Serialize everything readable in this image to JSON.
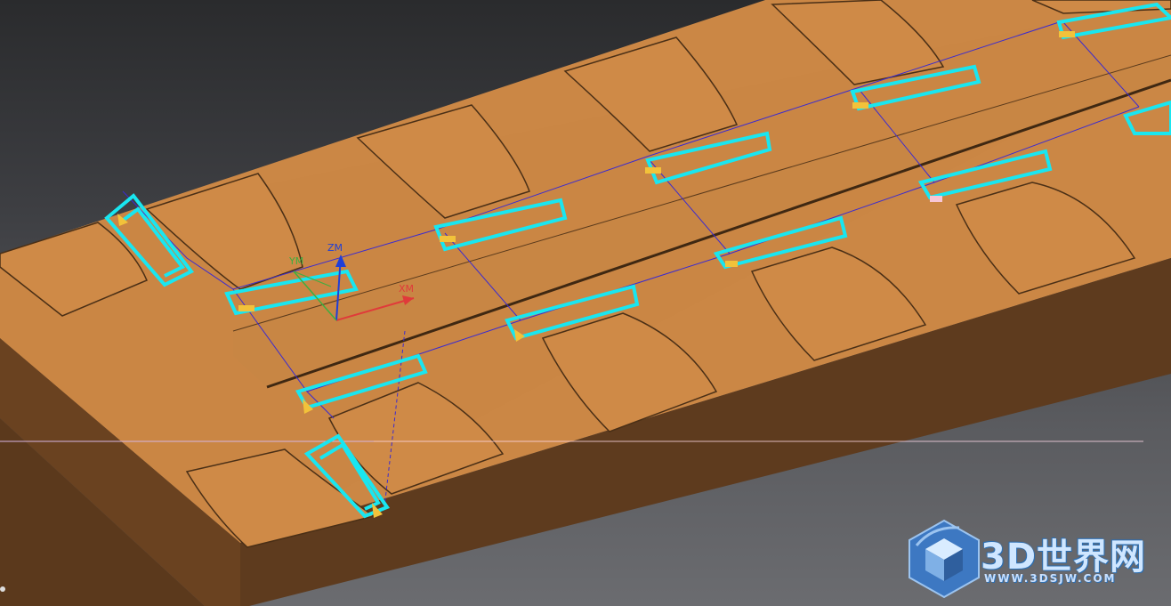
{
  "viewport": {
    "axes": {
      "x_label": "XM",
      "y_label": "YM",
      "z_label": "ZM",
      "x_color": "#e03a3a",
      "y_color": "#3fae3f",
      "z_color": "#1f3fd8"
    }
  },
  "colors": {
    "part_top": "#cd8845",
    "part_side": "#5e3a1e",
    "part_front": "#7a4b25",
    "toolpath": "#19e6f0",
    "path_link": "#3b2bd0",
    "marker": "#f2c23a"
  },
  "watermark": {
    "title": "3D世界网",
    "url": "WWW.3DSJW.COM",
    "icon": "cube-logo-icon"
  }
}
